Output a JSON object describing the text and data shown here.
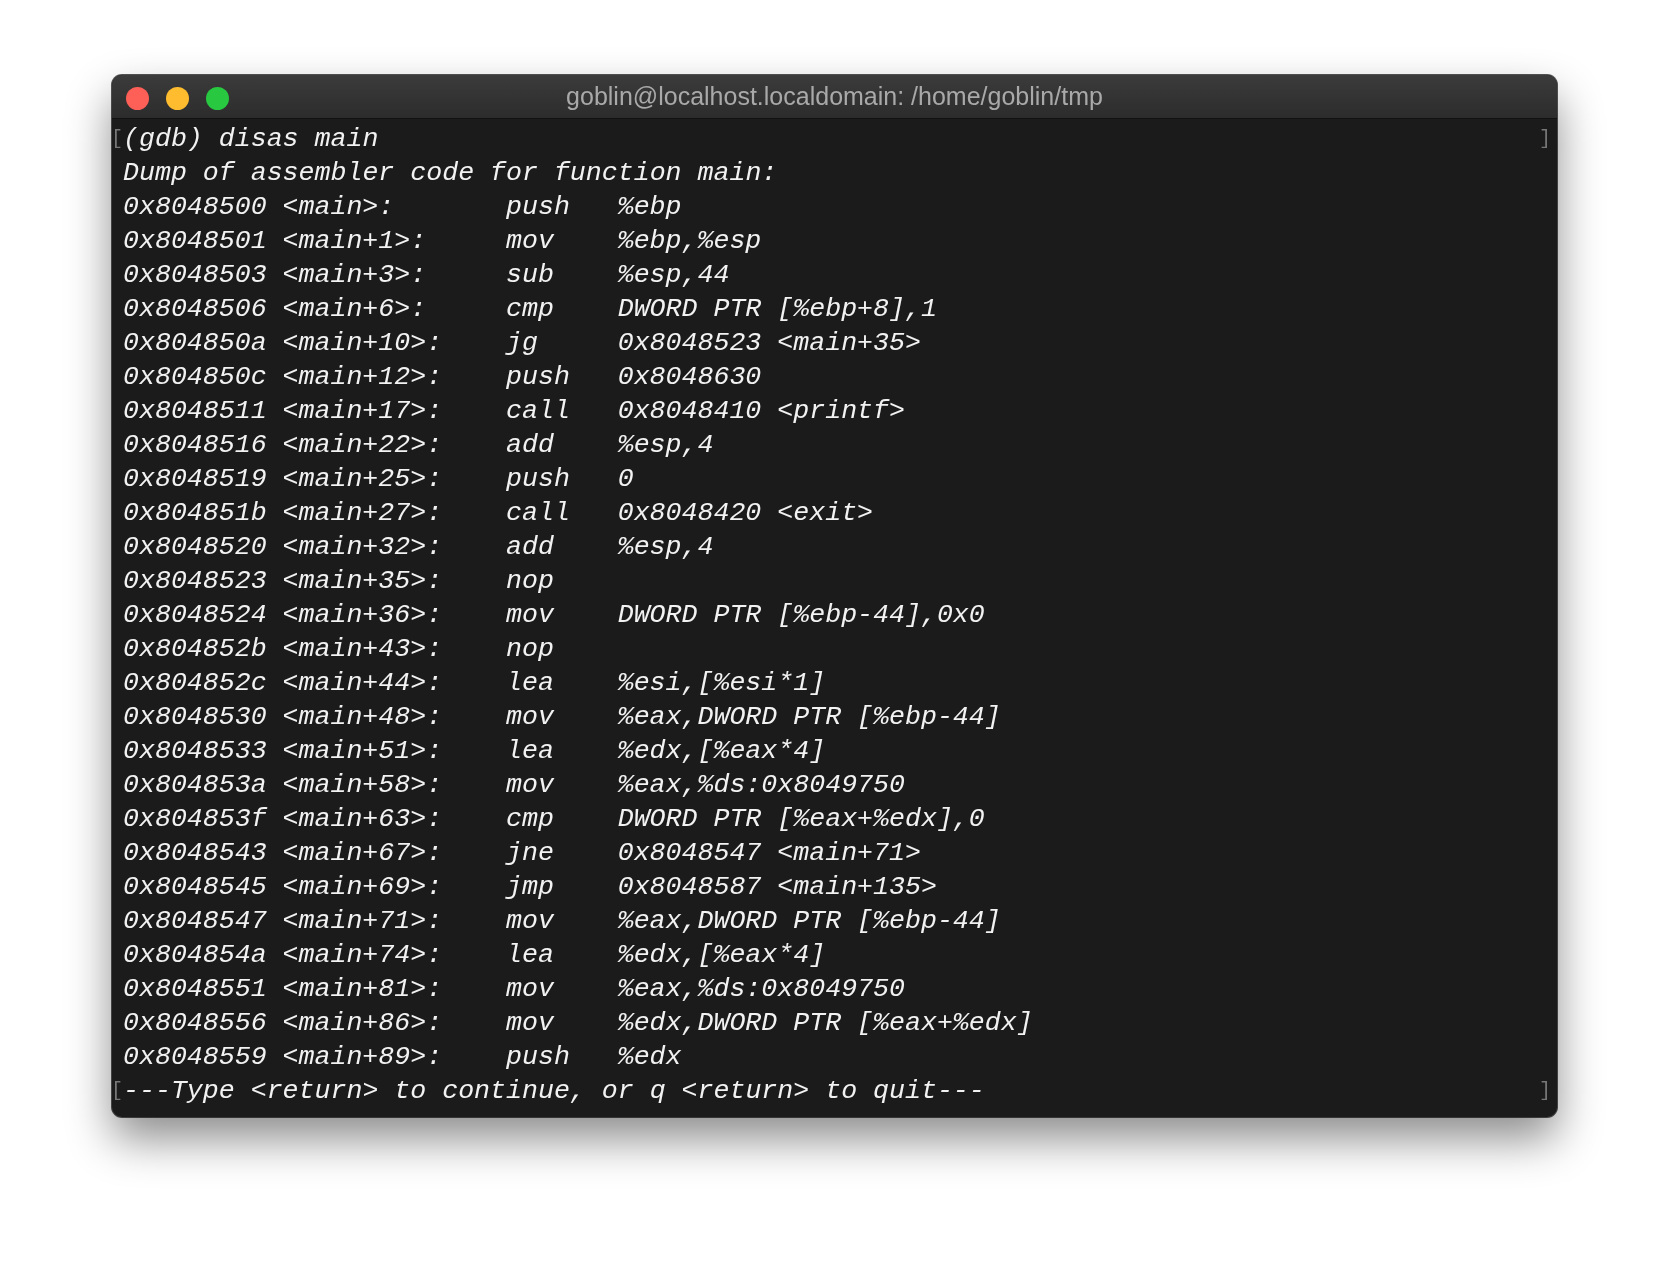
{
  "window": {
    "title": "goblin@localhost.localdomain: /home/goblin/tmp"
  },
  "lines": [
    {
      "kind": "text",
      "text": "(gdb) disas main",
      "open_mark": "[",
      "close_mark": "]"
    },
    {
      "kind": "text",
      "text": "Dump of assembler code for function main:"
    },
    {
      "kind": "asm",
      "address": "0x8048500",
      "symbol": "<main>:",
      "mnemonic": "push",
      "operands": "%ebp"
    },
    {
      "kind": "asm",
      "address": "0x8048501",
      "symbol": "<main+1>:",
      "mnemonic": "mov",
      "operands": "%ebp,%esp"
    },
    {
      "kind": "asm",
      "address": "0x8048503",
      "symbol": "<main+3>:",
      "mnemonic": "sub",
      "operands": "%esp,44"
    },
    {
      "kind": "asm",
      "address": "0x8048506",
      "symbol": "<main+6>:",
      "mnemonic": "cmp",
      "operands": "DWORD PTR [%ebp+8],1"
    },
    {
      "kind": "asm",
      "address": "0x804850a",
      "symbol": "<main+10>:",
      "mnemonic": "jg",
      "operands": "0x8048523 <main+35>"
    },
    {
      "kind": "asm",
      "address": "0x804850c",
      "symbol": "<main+12>:",
      "mnemonic": "push",
      "operands": "0x8048630"
    },
    {
      "kind": "asm",
      "address": "0x8048511",
      "symbol": "<main+17>:",
      "mnemonic": "call",
      "operands": "0x8048410 <printf>"
    },
    {
      "kind": "asm",
      "address": "0x8048516",
      "symbol": "<main+22>:",
      "mnemonic": "add",
      "operands": "%esp,4"
    },
    {
      "kind": "asm",
      "address": "0x8048519",
      "symbol": "<main+25>:",
      "mnemonic": "push",
      "operands": "0"
    },
    {
      "kind": "asm",
      "address": "0x804851b",
      "symbol": "<main+27>:",
      "mnemonic": "call",
      "operands": "0x8048420 <exit>"
    },
    {
      "kind": "asm",
      "address": "0x8048520",
      "symbol": "<main+32>:",
      "mnemonic": "add",
      "operands": "%esp,4"
    },
    {
      "kind": "asm",
      "address": "0x8048523",
      "symbol": "<main+35>:",
      "mnemonic": "nop"
    },
    {
      "kind": "asm",
      "address": "0x8048524",
      "symbol": "<main+36>:",
      "mnemonic": "mov",
      "operands": "DWORD PTR [%ebp-44],0x0"
    },
    {
      "kind": "asm",
      "address": "0x804852b",
      "symbol": "<main+43>:",
      "mnemonic": "nop"
    },
    {
      "kind": "asm",
      "address": "0x804852c",
      "symbol": "<main+44>:",
      "mnemonic": "lea",
      "operands": "%esi,[%esi*1]"
    },
    {
      "kind": "asm",
      "address": "0x8048530",
      "symbol": "<main+48>:",
      "mnemonic": "mov",
      "operands": "%eax,DWORD PTR [%ebp-44]"
    },
    {
      "kind": "asm",
      "address": "0x8048533",
      "symbol": "<main+51>:",
      "mnemonic": "lea",
      "operands": "%edx,[%eax*4]"
    },
    {
      "kind": "asm",
      "address": "0x804853a",
      "symbol": "<main+58>:",
      "mnemonic": "mov",
      "operands": "%eax,%ds:0x8049750"
    },
    {
      "kind": "asm",
      "address": "0x804853f",
      "symbol": "<main+63>:",
      "mnemonic": "cmp",
      "operands": "DWORD PTR [%eax+%edx],0"
    },
    {
      "kind": "asm",
      "address": "0x8048543",
      "symbol": "<main+67>:",
      "mnemonic": "jne",
      "operands": "0x8048547 <main+71>"
    },
    {
      "kind": "asm",
      "address": "0x8048545",
      "symbol": "<main+69>:",
      "mnemonic": "jmp",
      "operands": "0x8048587 <main+135>"
    },
    {
      "kind": "asm",
      "address": "0x8048547",
      "symbol": "<main+71>:",
      "mnemonic": "mov",
      "operands": "%eax,DWORD PTR [%ebp-44]"
    },
    {
      "kind": "asm",
      "address": "0x804854a",
      "symbol": "<main+74>:",
      "mnemonic": "lea",
      "operands": "%edx,[%eax*4]"
    },
    {
      "kind": "asm",
      "address": "0x8048551",
      "symbol": "<main+81>:",
      "mnemonic": "mov",
      "operands": "%eax,%ds:0x8049750"
    },
    {
      "kind": "asm",
      "address": "0x8048556",
      "symbol": "<main+86>:",
      "mnemonic": "mov",
      "operands": "%edx,DWORD PTR [%eax+%edx]"
    },
    {
      "kind": "asm",
      "address": "0x8048559",
      "symbol": "<main+89>:",
      "mnemonic": "push",
      "operands": "%edx"
    },
    {
      "kind": "text",
      "text": "---Type <return> to continue, or q <return> to quit---",
      "open_mark": "[",
      "close_mark": "]"
    }
  ]
}
